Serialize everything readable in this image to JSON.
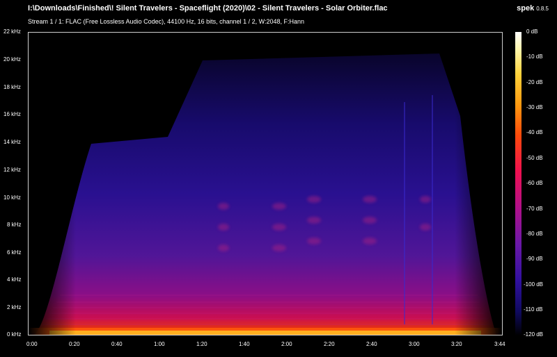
{
  "window": {
    "title": "I:\\Downloads\\Finished\\! Silent Travelers - Spaceflight (2020)\\02 - Silent Travelers - Solar Orbiter.flac",
    "stream_info": "Stream 1 / 1: FLAC (Free Lossless Audio Codec), 44100 Hz, 16 bits, channel 1 / 2, W:2048, F:Hann",
    "app_name": "spek",
    "app_version": "0.8.5"
  },
  "frequency_axis": {
    "labels": [
      "22 kHz",
      "20 kHz",
      "18 kHz",
      "16 kHz",
      "14 kHz",
      "12 kHz",
      "10 kHz",
      "8 kHz",
      "6 kHz",
      "4 kHz",
      "2 kHz",
      "0 kHz"
    ]
  },
  "time_axis": {
    "labels": [
      "0:00",
      "0:20",
      "0:40",
      "1:00",
      "1:20",
      "1:40",
      "2:00",
      "2:20",
      "2:40",
      "3:00",
      "3:20",
      "3:44"
    ]
  },
  "colorbar": {
    "labels": [
      "0 dB",
      "-10 dB",
      "-20 dB",
      "-30 dB",
      "-40 dB",
      "-50 dB",
      "-60 dB",
      "-70 dB",
      "-80 dB",
      "-90 dB",
      "-100 dB",
      "-110 dB",
      "-120 dB"
    ]
  },
  "colors": {
    "background": "#000000",
    "low_energy": "#2a0a70",
    "mid_energy": "#b0108a",
    "high_energy": "#ff4a0a",
    "peak_energy": "#ffd23a"
  }
}
